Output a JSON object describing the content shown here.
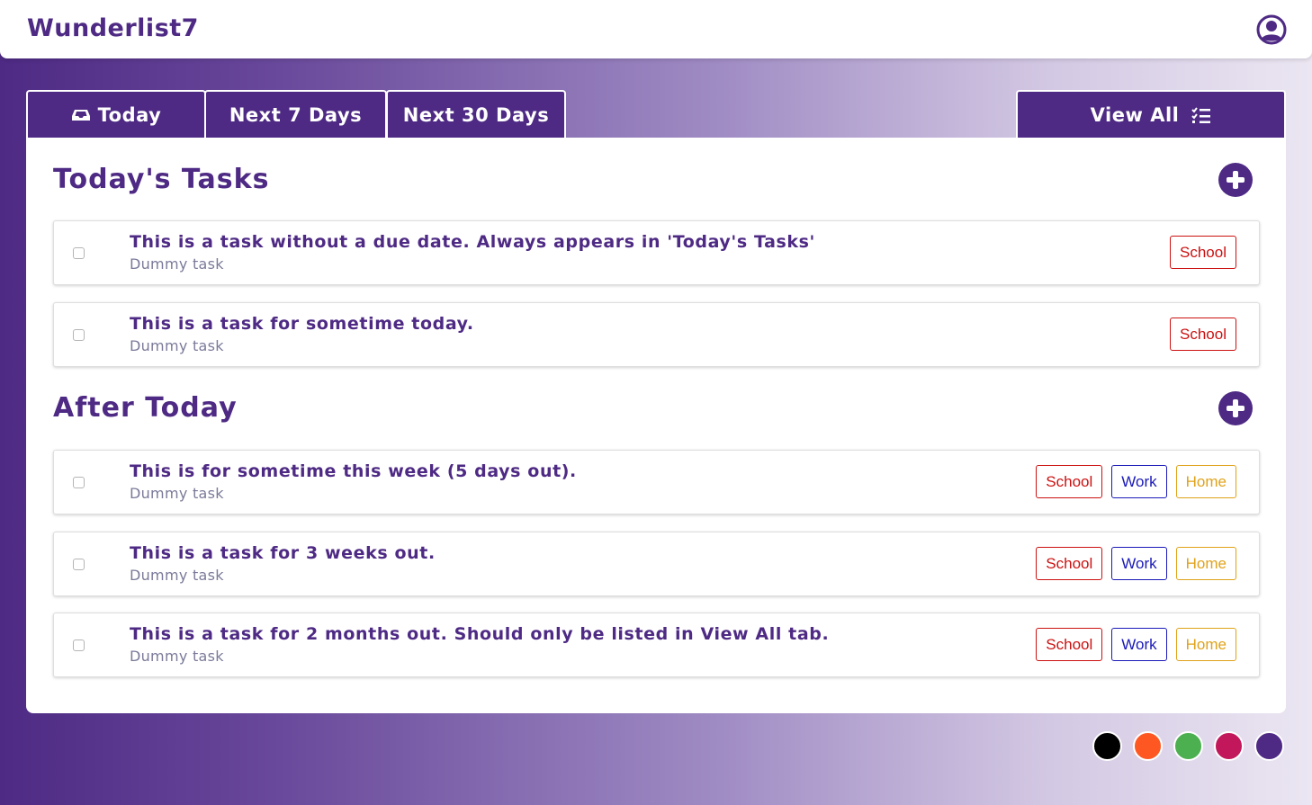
{
  "app": {
    "title": "Wunderlist7"
  },
  "tabs": {
    "today": "Today",
    "next7": "Next 7 Days",
    "next30": "Next 30 Days",
    "view_all": "View All"
  },
  "sections": {
    "today": {
      "title": "Today's Tasks",
      "tasks": [
        {
          "title": "This is a task without a due date. Always appears in 'Today's Tasks'",
          "desc": "Dummy task",
          "tags": [
            "School"
          ]
        },
        {
          "title": "This is a task for sometime today.",
          "desc": "Dummy task",
          "tags": [
            "School"
          ]
        }
      ]
    },
    "after": {
      "title": "After Today",
      "tasks": [
        {
          "title": "This is for sometime this week (5 days out).",
          "desc": "Dummy task",
          "tags": [
            "School",
            "Work",
            "Home"
          ]
        },
        {
          "title": "This is a task for 3 weeks out.",
          "desc": "Dummy task",
          "tags": [
            "School",
            "Work",
            "Home"
          ]
        },
        {
          "title": "This is a task for 2 months out. Should only be listed in View All tab.",
          "desc": "Dummy task",
          "tags": [
            "School",
            "Work",
            "Home"
          ]
        }
      ]
    }
  },
  "tag_colors": {
    "School": "#cc1111",
    "Work": "#1a1ab8",
    "Home": "#e0a21a"
  },
  "colors": {
    "brand": "#4e2a84"
  },
  "theme_swatches": [
    {
      "name": "black",
      "color": "#000000"
    },
    {
      "name": "orange",
      "color": "#ff5722"
    },
    {
      "name": "green",
      "color": "#4caf50"
    },
    {
      "name": "crimson",
      "color": "#c2185b"
    },
    {
      "name": "purple",
      "color": "#4e2a84"
    }
  ]
}
